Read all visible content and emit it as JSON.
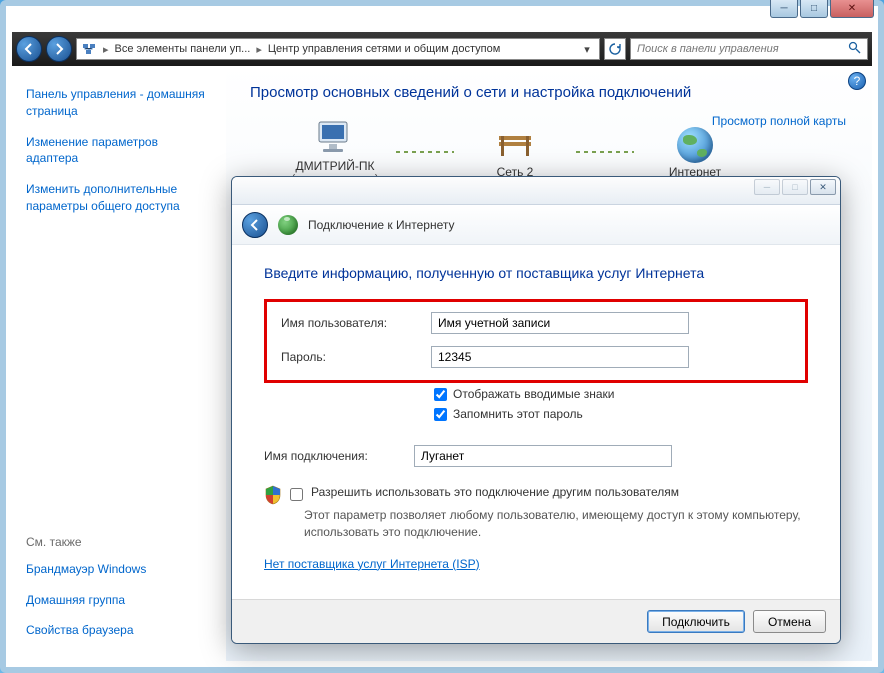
{
  "outer_window": {
    "min_tip": "Свернуть",
    "max_tip": "Развернуть",
    "close_tip": "Закрыть"
  },
  "address_bar": {
    "icon_label": "network-icon",
    "crumb1": "Все элементы панели уп...",
    "crumb2": "Центр управления сетями и общим доступом",
    "search_placeholder": "Поиск в панели управления"
  },
  "sidebar": {
    "home": "Панель управления - домашняя страница",
    "adapter": "Изменение параметров адаптера",
    "sharing": "Изменить дополнительные параметры общего доступа",
    "see_also": "См. также",
    "firewall": "Брандмауэр Windows",
    "homegroup": "Домашняя группа",
    "browser_props": "Свойства браузера"
  },
  "main": {
    "title": "Просмотр основных сведений о сети и настройка подключений",
    "node_pc": "ДМИТРИЙ-ПК",
    "node_pc_sub": "(этот компьютер)",
    "node_net": "Сеть 2",
    "node_inet": "Интернет",
    "full_map": "Просмотр полной карты"
  },
  "dialog": {
    "title": "Подключение к Интернету",
    "heading": "Введите информацию, полученную от поставщика услуг Интернета",
    "username_label": "Имя пользователя:",
    "username_value": "Имя учетной записи",
    "password_label": "Пароль:",
    "password_value": "12345",
    "show_chars": "Отображать вводимые знаки",
    "remember": "Запомнить этот пароль",
    "conn_name_label": "Имя подключения:",
    "conn_name_value": "Луганет",
    "share_check": "Разрешить использовать это подключение другим пользователям",
    "share_desc": "Этот параметр позволяет любому пользователю, имеющему доступ к этому компьютеру, использовать это подключение.",
    "isp_link": "Нет поставщика услуг Интернета (ISP)",
    "connect_btn": "Подключить",
    "cancel_btn": "Отмена"
  }
}
